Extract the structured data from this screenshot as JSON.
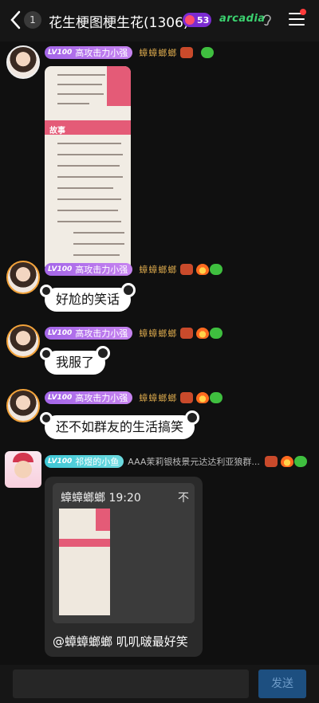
{
  "header": {
    "back_icon": "chevron-left-icon",
    "unread_count": "1",
    "title": "花生梗图梗生花(1306)",
    "hot_count": "53",
    "brand_badge": "arcadia",
    "accent": "#7b2bd1"
  },
  "messages": [
    {
      "level": "LV100",
      "title": "高攻击力小强",
      "nickname": "蟑蟑螂螂",
      "type": "image"
    },
    {
      "level": "LV100",
      "title": "高攻击力小强",
      "nickname": "蟑蟑螂螂",
      "text": "好尬的笑话"
    },
    {
      "level": "LV100",
      "title": "高攻击力小强",
      "nickname": "蟑蟑螂螂",
      "text": "我服了"
    },
    {
      "level": "LV100",
      "title": "高攻击力小强",
      "nickname": "蟑蟑螂螂",
      "text": "还不如群友的生活搞笑"
    },
    {
      "level": "LV100",
      "title": "祁煜的小鱼",
      "nickname": "AAA茉莉银枝景元达达利亚狼群...",
      "quote": {
        "author": "蟑蟑螂螂",
        "time": "19:20",
        "pin_glyph": "不"
      },
      "text": "@蟑蟑螂螂 叽叽啵最好笑"
    }
  ],
  "image_text": {
    "heading": "故事"
  },
  "composer": {
    "send_label": "发送",
    "send_color": "#1d4f80"
  }
}
